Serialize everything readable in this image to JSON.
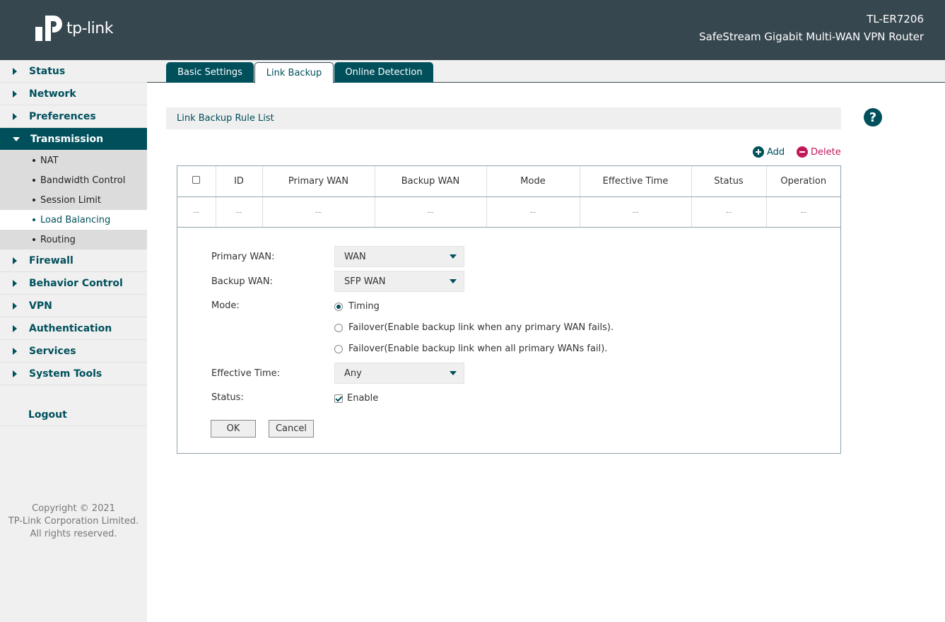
{
  "header": {
    "logo_text": "tp-link",
    "model": "TL-ER7206",
    "subtitle": "SafeStream Gigabit Multi-WAN VPN Router"
  },
  "sidebar": {
    "items": [
      {
        "label": "Status"
      },
      {
        "label": "Network"
      },
      {
        "label": "Preferences"
      },
      {
        "label": "Transmission"
      },
      {
        "label": "Firewall"
      },
      {
        "label": "Behavior Control"
      },
      {
        "label": "VPN"
      },
      {
        "label": "Authentication"
      },
      {
        "label": "Services"
      },
      {
        "label": "System Tools"
      }
    ],
    "subitems": [
      {
        "label": "NAT"
      },
      {
        "label": "Bandwidth Control"
      },
      {
        "label": "Session Limit"
      },
      {
        "label": "Load Balancing"
      },
      {
        "label": "Routing"
      }
    ],
    "logout": "Logout",
    "copyright": [
      "Copyright © 2021",
      "TP-Link Corporation Limited.",
      "All rights reserved."
    ]
  },
  "tabs": [
    {
      "label": "Basic Settings"
    },
    {
      "label": "Link Backup"
    },
    {
      "label": "Online Detection"
    }
  ],
  "content": {
    "section_title": "Link Backup Rule List",
    "help": "?",
    "add_label": "Add",
    "delete_label": "Delete",
    "table": {
      "headers": [
        "ID",
        "Primary WAN",
        "Backup WAN",
        "Mode",
        "Effective Time",
        "Status",
        "Operation"
      ],
      "row": [
        "--",
        "--",
        "--",
        "--",
        "--",
        "--",
        "--",
        "--"
      ]
    },
    "form": {
      "primary_wan_label": "Primary WAN:",
      "primary_wan_value": "WAN",
      "backup_wan_label": "Backup WAN:",
      "backup_wan_value": "SFP WAN",
      "mode_label": "Mode:",
      "mode_options": [
        "Timing",
        "Failover(Enable backup link when any primary WAN fails).",
        "Failover(Enable backup link when all primary WANs fail)."
      ],
      "effective_time_label": "Effective Time:",
      "effective_time_value": "Any",
      "status_label": "Status:",
      "status_enable": "Enable",
      "ok": "OK",
      "cancel": "Cancel"
    }
  },
  "colors": {
    "header_bg": "#37474f",
    "accent": "#00505c",
    "delete": "#c2185b"
  }
}
